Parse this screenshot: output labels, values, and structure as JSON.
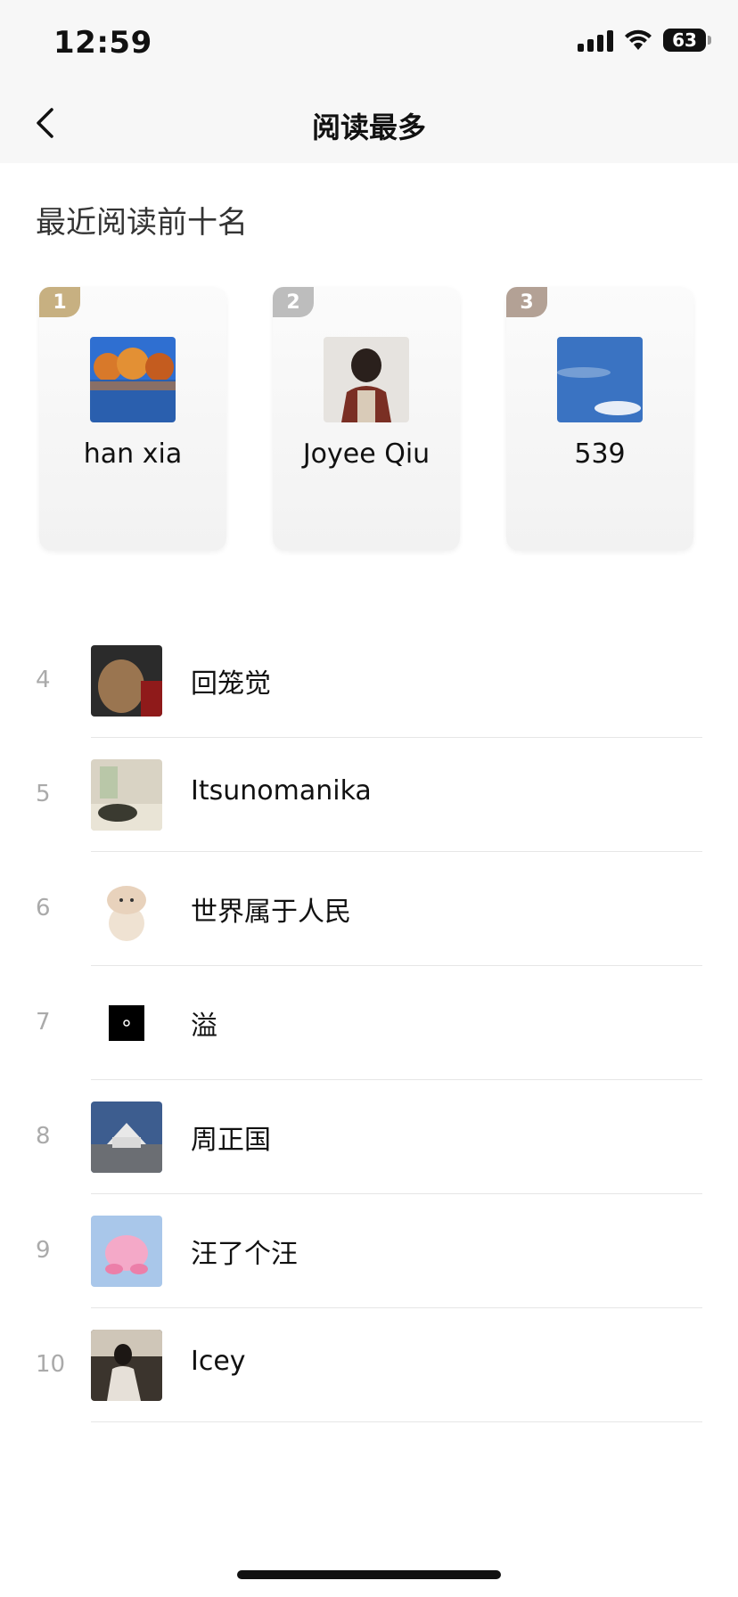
{
  "status_bar": {
    "time": "12:59",
    "battery": "63"
  },
  "nav": {
    "title": "阅读最多",
    "back_icon": "chevron-left-icon"
  },
  "section": {
    "title": "最近阅读前十名"
  },
  "top3": [
    {
      "rank": "1",
      "name": "han xia"
    },
    {
      "rank": "2",
      "name": "Joyee Qiu"
    },
    {
      "rank": "3",
      "name": "539"
    }
  ],
  "list": [
    {
      "rank": "4",
      "name": "回笼觉"
    },
    {
      "rank": "5",
      "name": "Itsunomanika"
    },
    {
      "rank": "6",
      "name": "世界属于人民"
    },
    {
      "rank": "7",
      "name": "溢"
    },
    {
      "rank": "8",
      "name": "周正国"
    },
    {
      "rank": "9",
      "name": "汪了个汪"
    },
    {
      "rank": "10",
      "name": "Icey"
    }
  ],
  "colors": {
    "gold": "#c7b081",
    "silver": "#bdbdbd",
    "bronze": "#b3a195"
  }
}
